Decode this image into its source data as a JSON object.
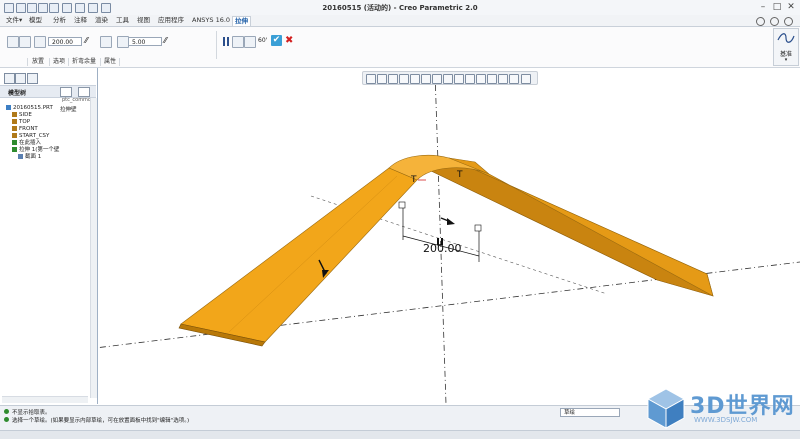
{
  "window": {
    "title": "20160515 (活动的) - Creo Parametric 2.0"
  },
  "menubar": {
    "items": [
      "文件",
      "模型",
      "分析",
      "注释",
      "渲染",
      "工具",
      "视图",
      "应用程序",
      "ANSYS 16.0",
      "拉伸"
    ],
    "active": "拉伸",
    "file_arrow": "▾"
  },
  "ribbon": {
    "depth_value": "200.00",
    "thickness_value": "5.00",
    "oo_label": "60'",
    "groups": [
      "放置",
      "选项",
      "属性",
      "属性"
    ],
    "group_labels": [
      "放置",
      "选项",
      "折弯余量",
      "属性"
    ],
    "right_panel_label": "基准",
    "right_panel_arrow": "▾"
  },
  "model_tree": {
    "tab_label": "模型树",
    "header_hint": "ptc_common_",
    "sub_header": "拉伸壁",
    "items": [
      {
        "label": "20160515.PRT",
        "icon": "part-icon",
        "indent": 0
      },
      {
        "label": "SIDE",
        "icon": "datum-plane-icon",
        "indent": 1
      },
      {
        "label": "TOP",
        "icon": "datum-plane-icon",
        "indent": 1
      },
      {
        "label": "FRONT",
        "icon": "datum-plane-icon",
        "indent": 1
      },
      {
        "label": "START_CSY",
        "icon": "csys-icon",
        "indent": 1
      },
      {
        "label": "在此插入",
        "icon": "insert-here-icon",
        "indent": 1
      },
      {
        "label": "拉伸 1(第一个壁",
        "icon": "extrude-icon",
        "indent": 1
      },
      {
        "label": "截面 1",
        "icon": "sketch-icon",
        "indent": 2
      }
    ]
  },
  "viewport": {
    "dimension_value": "200.00",
    "label_t1": "T",
    "label_t2": "T"
  },
  "status": {
    "messages": [
      "不显示拾取表。",
      "选择一个草绘。(如果要显示内部草绘，可在放置面板中找到\"编辑\"选项。)"
    ],
    "filter_label": "草绘"
  },
  "watermark": {
    "text": "3D世界网",
    "url": "WWW.3DSJW.COM"
  },
  "colors": {
    "accent": "#1f5fa8",
    "part_fill": "#f2a61a",
    "part_dark": "#c9810a",
    "confirm_green": "#2e8b2e",
    "cancel_red": "#d22020"
  }
}
